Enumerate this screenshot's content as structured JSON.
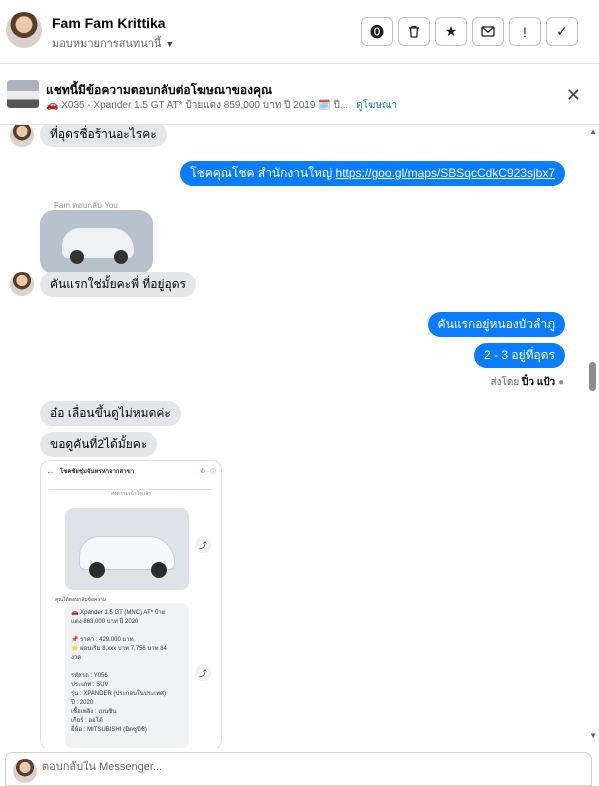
{
  "header": {
    "name": "Fam Fam Krittika",
    "assign_label": "มอบหมายการสนทนานี้",
    "actions": [
      "report-icon",
      "trash-icon",
      "star-icon",
      "mail-icon",
      "exclamation-icon",
      "check-icon"
    ]
  },
  "banner": {
    "title": "แชทนี้มีข้อความตอบกลับต่อโฆษณาของคุณ",
    "subtitle": "X035 - Xpander 1.5 GT AT* ป้ายแดง 859,000 บาท ปี 2019 🗓️ ปี...",
    "link": "ดูโฆษณา"
  },
  "messages": {
    "m1": "ที่อุดรชื่อร้านอะไรคะ",
    "m2_text": "โชคคุณโชค สำนักงานใหญ่",
    "m2_link": "https://goo.gl/maps/SBSqcCdkC923sjbx7",
    "reply_label": "Fam ตอบกลับ You",
    "m3": "คันแรกใช่มั้ยคะพี่ ที่อยู่อุดร",
    "m4": "คันแรกอยู่หนองบัวลำภู",
    "m5": "2 - 3  อยู่ที่อุดร",
    "sent_by_prefix": "ส่งโดย",
    "sent_by_name": "ปิ๋ว แป้ว",
    "m6": "อ๋อ เลื่อนขึ้นดูไม่หมดค่ะ",
    "m7": "ขอดูคันที่2ได้มั้ยคะ"
  },
  "screenshot": {
    "header_title": "โชคชัยชุ่มจันทรหาจากสาขา",
    "separator": "ส่งความเข้าใจแล้ว",
    "caption": "คุณได้ตอบกลับข้อความ",
    "card_lines": [
      "🚗 Xpander 1.5 GT (MNC) AT* ป้าย",
      "แดง 863,000 บาท ปี 2020",
      "",
      "📌 ราคา : 429,000 บาท",
      "⭐ ผ่อนเริ่ม 8,xxx บาท 7,756 บาท 84",
      "งวด",
      "",
      "รหัสรถ : Y056",
      "ประเภท : SUV",
      "รุ่น : XPANDER (ประกอบในประเทศ)",
      "ปี : 2020",
      "เชื้อเพลิง : เบนซิน",
      "เกียร์ : ออโต้",
      "ยี่ห้อ : MITSUBISHI (มิตซูบิชิ)"
    ]
  },
  "composer": {
    "placeholder": "ตอบกลับใน Messenger..."
  }
}
